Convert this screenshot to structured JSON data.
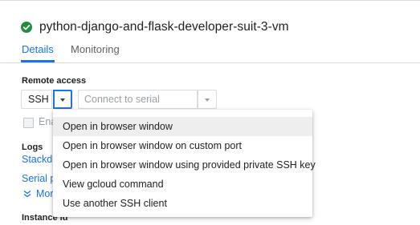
{
  "vm": {
    "name": "python-django-and-flask-developer-suit-3-vm",
    "status_icon": "check-circle-icon",
    "status_color": "#1e8e3e"
  },
  "tabs": [
    {
      "label": "Details",
      "active": true
    },
    {
      "label": "Monitoring",
      "active": false
    }
  ],
  "remote_access": {
    "label": "Remote access",
    "ssh_label": "SSH",
    "serial_label": "Connect to serial console",
    "enable_text": "Ena",
    "enable_checked": false
  },
  "ssh_menu": {
    "items": [
      "Open in browser window",
      "Open in browser window on custom port",
      "Open in browser window using provided private SSH key",
      "View gcloud command",
      "Use another SSH client"
    ],
    "highlighted_index": 0
  },
  "logs": {
    "label": "Logs",
    "stackdriver_link": "Stackdr",
    "serial_link": "Serial p",
    "more_link": "Mor"
  },
  "instance": {
    "label": "Instance id"
  },
  "colors": {
    "accent": "#1a73e8",
    "success": "#1e8e3e",
    "text": "#202124",
    "muted": "#9aa0a6"
  }
}
